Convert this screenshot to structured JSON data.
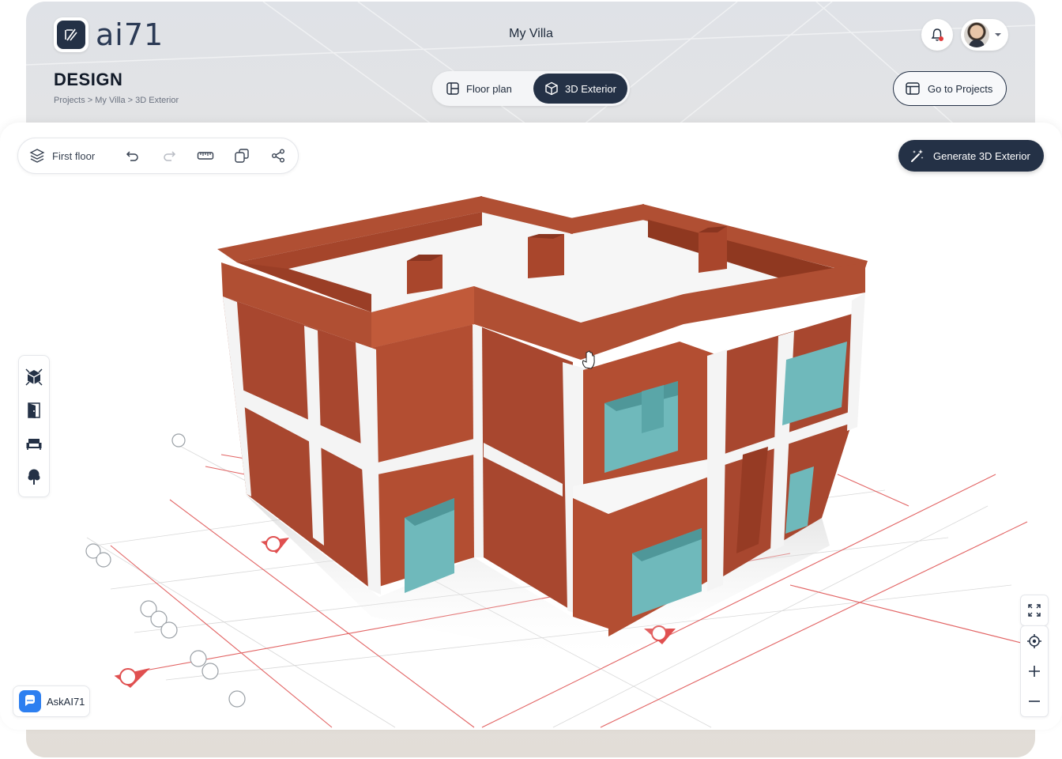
{
  "header": {
    "logo_text": "ai71",
    "app_title": "My Villa",
    "page_heading": "DESIGN",
    "breadcrumb": "Projects > My Villa > 3D Exterior",
    "view_toggle": {
      "floor_plan": "Floor plan",
      "exterior_3d": "3D Exterior",
      "active": "3D Exterior"
    },
    "go_to_projects": "Go to Projects",
    "icons": {
      "bell": "bell-icon",
      "avatar": "user-avatar",
      "dropdown": "chevron-down-icon"
    }
  },
  "toolbar": {
    "floor_label": "First floor",
    "icons": [
      "layers-icon",
      "undo-icon",
      "redo-icon",
      "ruler-icon",
      "copy-icon",
      "share-icon"
    ]
  },
  "generate_button": "Generate 3D Exterior",
  "side_tools": [
    "3d-cube-icon",
    "door-icon",
    "sofa-icon",
    "tree-icon"
  ],
  "view_controls": [
    "fullscreen-icon",
    "locate-icon",
    "zoom-in-icon",
    "zoom-out-icon"
  ],
  "assistant_button": "AskAI71",
  "colors": {
    "primary": "#243146",
    "brick": "#a8472f",
    "glass": "#6fb9bb",
    "grid_red": "#e05a5a"
  }
}
